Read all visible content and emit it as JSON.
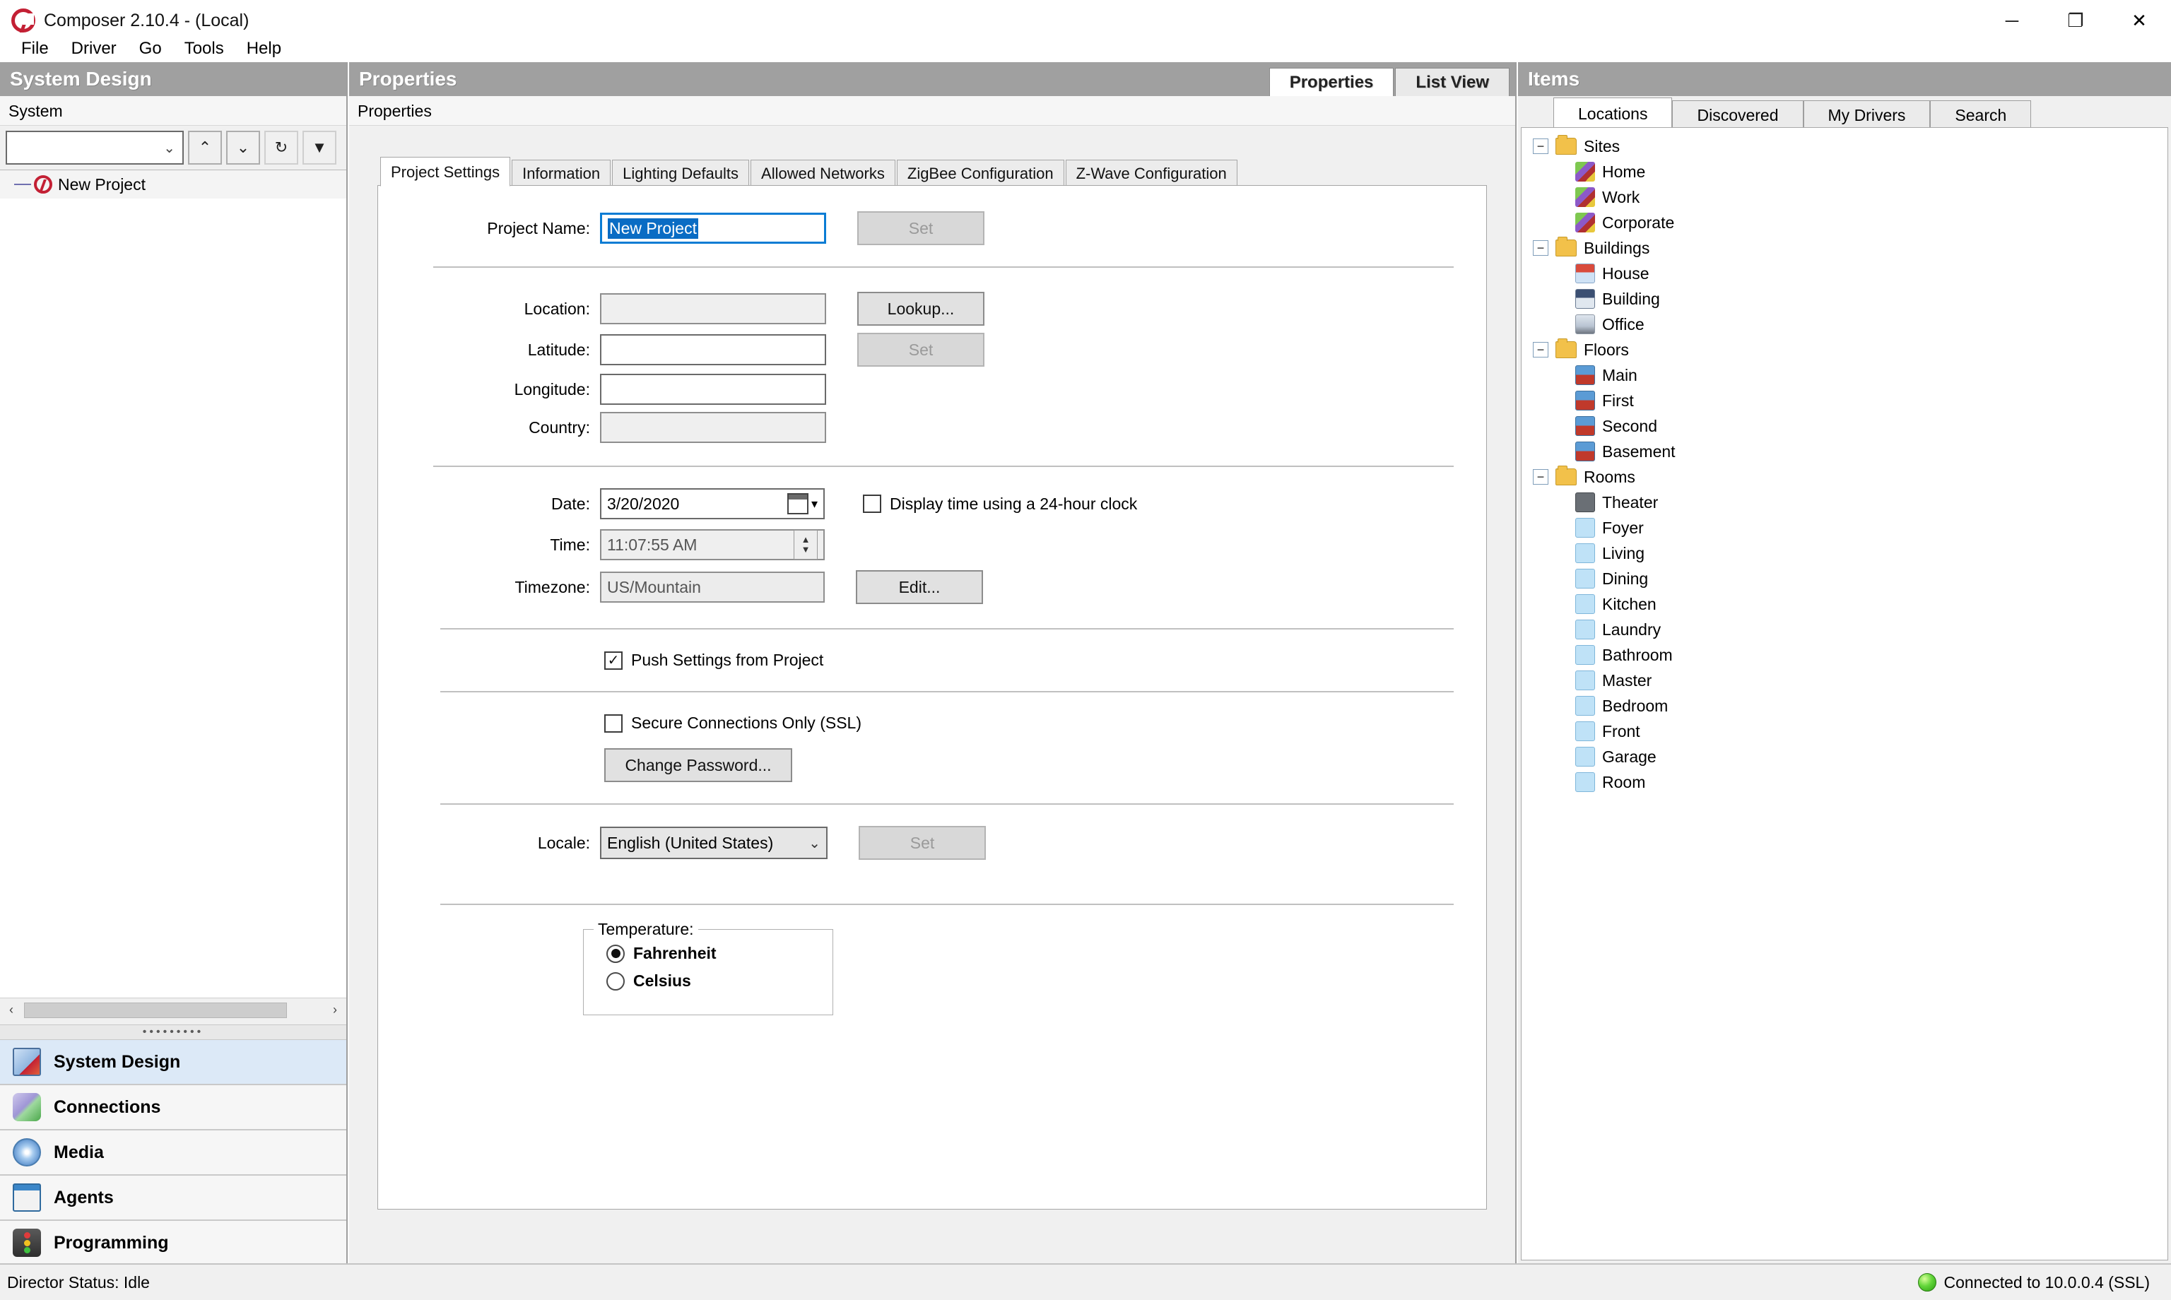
{
  "window": {
    "title": "Composer 2.10.4 - (Local)",
    "logo_icon": "c4-logo-icon",
    "minimize_icon": "minimize-icon",
    "maximize_icon": "maximize-icon",
    "close_icon": "close-icon",
    "minimize_glyph": "─",
    "maximize_glyph": "❐",
    "close_glyph": "✕"
  },
  "menu": {
    "items": [
      {
        "label": "File"
      },
      {
        "label": "Driver"
      },
      {
        "label": "Go"
      },
      {
        "label": "Tools"
      },
      {
        "label": "Help"
      }
    ]
  },
  "left_panel": {
    "header": "System Design",
    "sub_label": "System",
    "system_combo": {
      "value": "",
      "caret": "⌄"
    },
    "toolbar": {
      "up_glyph": "⌃",
      "down_glyph": "⌄",
      "refresh_glyph": "↻",
      "filter_glyph": "▼"
    },
    "tree": {
      "root_label": "New Project"
    },
    "hscroll": {
      "left_glyph": "‹",
      "right_glyph": "›"
    },
    "nav_items": [
      {
        "label": "System Design",
        "icon": "system-design-icon",
        "selected": true
      },
      {
        "label": "Connections",
        "icon": "connections-icon",
        "selected": false
      },
      {
        "label": "Media",
        "icon": "media-icon",
        "selected": false
      },
      {
        "label": "Agents",
        "icon": "agents-icon",
        "selected": false
      },
      {
        "label": "Programming",
        "icon": "programming-icon",
        "selected": false
      }
    ]
  },
  "center_panel": {
    "header": "Properties",
    "sub_label": "Properties",
    "header_tabs": [
      {
        "label": "Properties",
        "active": true
      },
      {
        "label": "List View",
        "active": false
      }
    ],
    "tabs": [
      {
        "label": "Project Settings",
        "active": true
      },
      {
        "label": "Information",
        "active": false
      },
      {
        "label": "Lighting Defaults",
        "active": false
      },
      {
        "label": "Allowed Networks",
        "active": false
      },
      {
        "label": "ZigBee Configuration",
        "active": false
      },
      {
        "label": "Z-Wave Configuration",
        "active": false
      }
    ],
    "project_settings": {
      "project_name_label": "Project Name:",
      "project_name_value": "New Project",
      "project_name_set_button": "Set",
      "location_label": "Location:",
      "location_value": "",
      "lookup_button": "Lookup...",
      "latitude_label": "Latitude:",
      "latitude_value": "",
      "longitude_label": "Longitude:",
      "longitude_value": "",
      "country_label": "Country:",
      "country_value": "",
      "location_set_button": "Set",
      "date_label": "Date:",
      "date_value": "3/20/2020",
      "date_caret": "▾",
      "clock_checkbox_label": "Display time using a 24-hour clock",
      "clock_checkbox_checked": false,
      "time_label": "Time:",
      "time_value": "11:07:55 AM",
      "spin_up": "▲",
      "spin_down": "▼",
      "timezone_label": "Timezone:",
      "timezone_value": "US/Mountain",
      "timezone_edit_button": "Edit...",
      "push_settings_label": "Push Settings from Project",
      "push_settings_checked": true,
      "check_glyph": "✓",
      "ssl_label": "Secure Connections Only (SSL)",
      "ssl_checked": false,
      "change_password_button": "Change Password...",
      "locale_label": "Locale:",
      "locale_value": "English (United States)",
      "locale_caret": "⌄",
      "locale_set_button": "Set",
      "temperature_group_label": "Temperature:",
      "temperature_options": [
        {
          "label": "Fahrenheit",
          "selected": true
        },
        {
          "label": "Celsius",
          "selected": false
        }
      ]
    }
  },
  "right_panel": {
    "header": "Items",
    "tabs": [
      {
        "label": "Locations",
        "active": true
      },
      {
        "label": "Discovered",
        "active": false
      },
      {
        "label": "My Drivers",
        "active": false
      },
      {
        "label": "Search",
        "active": false
      }
    ],
    "tree": [
      {
        "label": "Sites",
        "expander": "−",
        "icon": "folder-icon",
        "children": [
          {
            "label": "Home",
            "icon": "site-icon"
          },
          {
            "label": "Work",
            "icon": "site-icon"
          },
          {
            "label": "Corporate",
            "icon": "site-icon"
          }
        ]
      },
      {
        "label": "Buildings",
        "expander": "−",
        "icon": "folder-icon",
        "children": [
          {
            "label": "House",
            "icon": "house-icon"
          },
          {
            "label": "Building",
            "icon": "building-icon"
          },
          {
            "label": "Office",
            "icon": "office-icon"
          }
        ]
      },
      {
        "label": "Floors",
        "expander": "−",
        "icon": "folder-icon",
        "children": [
          {
            "label": "Main",
            "icon": "floor-icon"
          },
          {
            "label": "First",
            "icon": "floor-icon"
          },
          {
            "label": "Second",
            "icon": "floor-icon"
          },
          {
            "label": "Basement",
            "icon": "floor-icon"
          }
        ]
      },
      {
        "label": "Rooms",
        "expander": "−",
        "icon": "folder-icon",
        "children": [
          {
            "label": "Theater",
            "icon": "theater-icon"
          },
          {
            "label": "Foyer",
            "icon": "room-icon"
          },
          {
            "label": "Living",
            "icon": "room-icon"
          },
          {
            "label": "Dining",
            "icon": "room-icon"
          },
          {
            "label": "Kitchen",
            "icon": "room-icon"
          },
          {
            "label": "Laundry",
            "icon": "room-icon"
          },
          {
            "label": "Bathroom",
            "icon": "room-icon"
          },
          {
            "label": "Master",
            "icon": "room-icon"
          },
          {
            "label": "Bedroom",
            "icon": "room-icon"
          },
          {
            "label": "Front",
            "icon": "room-icon"
          },
          {
            "label": "Garage",
            "icon": "room-icon"
          },
          {
            "label": "Room",
            "icon": "room-icon"
          }
        ]
      }
    ]
  },
  "status_bar": {
    "director_status": "Director Status: Idle",
    "connection_text": "Connected to 10.0.0.4 (SSL)",
    "connection_indicator": "green-status-dot"
  }
}
